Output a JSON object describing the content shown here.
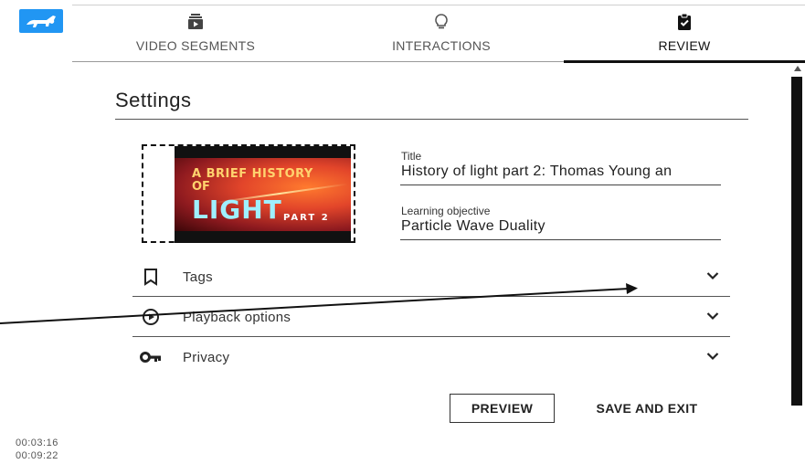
{
  "tabs": [
    {
      "label": "VIDEO SEGMENTS",
      "icon": "video-stack-icon"
    },
    {
      "label": "INTERACTIONS",
      "icon": "lightbulb-icon"
    },
    {
      "label": "REVIEW",
      "icon": "clipboard-check-icon",
      "active": true
    }
  ],
  "settings": {
    "heading": "Settings",
    "thumbnail": {
      "line1": "A BRIEF HISTORY",
      "line2": "OF",
      "line3": "LIGHT",
      "line4": "PART 2"
    },
    "title_label": "Title",
    "title_value": "History of light part 2: Thomas Young an",
    "objective_label": "Learning objective",
    "objective_value": "Particle Wave Duality"
  },
  "accordion": [
    {
      "label": "Tags",
      "icon": "bookmark-icon"
    },
    {
      "label": "Playback options",
      "icon": "play-circle-icon"
    },
    {
      "label": "Privacy",
      "icon": "key-icon"
    }
  ],
  "actions": {
    "preview": "PREVIEW",
    "save_exit": "SAVE AND EXIT"
  },
  "timecodes": {
    "current": "00:03:16",
    "total": "00:09:22"
  },
  "colors": {
    "logo_blue": "#2196f3",
    "text_dark": "#222222",
    "active_tab_indicator": "#111111"
  }
}
